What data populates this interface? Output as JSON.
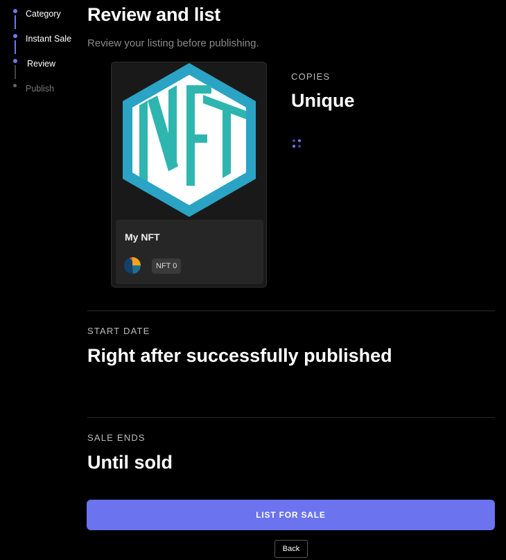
{
  "stepper": {
    "steps": [
      {
        "label": "Category"
      },
      {
        "label": "Instant Sale"
      },
      {
        "label": "Review"
      },
      {
        "label": "Publish"
      }
    ]
  },
  "header": {
    "title": "Review and list",
    "subtitle": "Review your listing before publishing."
  },
  "card": {
    "image_text": "NFT",
    "name": "My NFT",
    "badge": "NFT 0"
  },
  "copies": {
    "label": "COPIES",
    "value": "Unique"
  },
  "start_date": {
    "label": "START DATE",
    "value": "Right after successfully published"
  },
  "sale_ends": {
    "label": "SALE ENDS",
    "value": "Until sold"
  },
  "actions": {
    "list_label": "LIST FOR SALE",
    "back_label": "Back"
  },
  "colors": {
    "accent": "#6b73ee",
    "logo_border": "#2aa3c4",
    "logo_text": "#2fb5b0"
  }
}
